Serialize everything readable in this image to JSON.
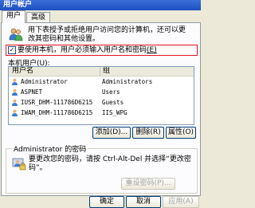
{
  "window": {
    "title": "用户帐户"
  },
  "tabs": [
    {
      "label": "用户"
    },
    {
      "label": "高级"
    }
  ],
  "description": "用下表授予或拒绝用户访问您的计算机，还可以更改其密码和其他设置。",
  "require_login": {
    "label": "要使用本机，用户必须输入用户名和密码",
    "shortcut": "(E)",
    "checked": true
  },
  "users_list": {
    "label": "本机用户(U):",
    "columns": [
      "用户名",
      "组"
    ],
    "rows": [
      {
        "name": "Administrator",
        "group": "Administrators"
      },
      {
        "name": "ASPNET",
        "group": "Users"
      },
      {
        "name": "IUSR_DHM-111786D6215",
        "group": "Guests"
      },
      {
        "name": "IWAM_DHM-111786D6215",
        "group": "IIS_WPG"
      }
    ]
  },
  "list_buttons": {
    "add": "添加(D)...",
    "remove": "删除(R)",
    "properties": "属性(O)"
  },
  "password_group": {
    "title": "Administrator 的密码",
    "text": "要更改您的密码，请按 Ctrl-Alt-Del 并选择“更改密码”。",
    "reset_button": "重设密码(P)..."
  },
  "footer": {
    "ok": "确定",
    "cancel": "取消",
    "apply": "应用(A)"
  },
  "colors": {
    "highlight_border": "#e8141e",
    "titlebar": "#1c4fc0"
  }
}
